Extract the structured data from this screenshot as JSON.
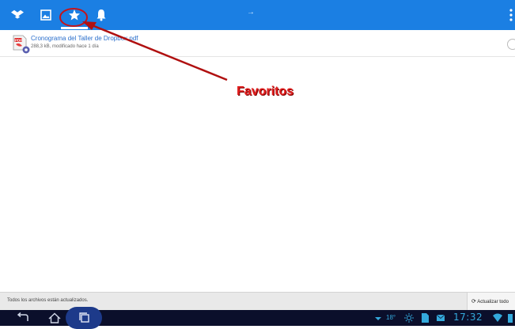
{
  "colors": {
    "topbar": "#1b7fe3",
    "link": "#2a6fcc",
    "annotation": "#e31f1f",
    "navbar": "#0b0f2b",
    "clock": "#34aadc"
  },
  "topbar": {
    "tabs": [
      {
        "icon": "dropbox-icon"
      },
      {
        "icon": "photos-icon"
      },
      {
        "icon": "star-icon",
        "selected": true
      },
      {
        "icon": "bell-icon"
      }
    ],
    "center_glyph": "→",
    "overflow_icon": "overflow-menu-icon"
  },
  "file": {
    "name": "Cronograma del Taller de Dropbox.pdf",
    "meta": "288,3 kB, modificado hace 1 día",
    "icon": "pdf-file-icon"
  },
  "annotation": {
    "label": "Favoritos"
  },
  "status": {
    "text": "Todos los archivos están actualizados.",
    "refresh_label": "Actualizar todo"
  },
  "navbar": {
    "temperature": "18°",
    "clock": "17:32"
  }
}
